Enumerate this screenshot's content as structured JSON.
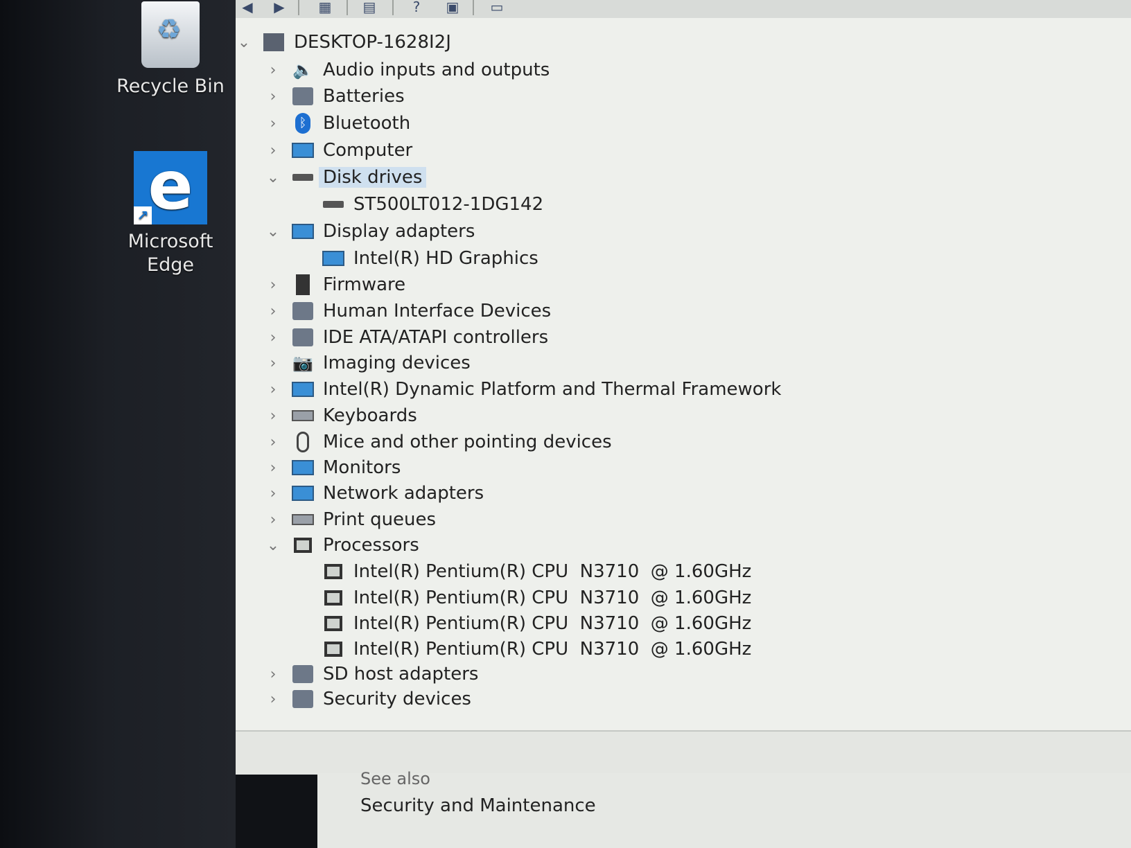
{
  "desktop": {
    "icons": [
      {
        "label": "Recycle Bin",
        "icon": "recycle-bin-icon"
      },
      {
        "label": "Microsoft Edge",
        "icon": "edge-icon"
      }
    ]
  },
  "toolbar": {
    "buttons": [
      "back-icon",
      "forward-icon",
      "show-hide-icon",
      "properties-icon",
      "help-icon",
      "update-driver-icon",
      "scan-hardware-icon"
    ]
  },
  "tree": {
    "root": "DESKTOP-1628I2J",
    "items": [
      {
        "label": "Audio inputs and outputs",
        "expanded": false,
        "icon": "speaker-icon"
      },
      {
        "label": "Batteries",
        "expanded": false,
        "icon": "battery-icon"
      },
      {
        "label": "Bluetooth",
        "expanded": false,
        "icon": "bluetooth-icon"
      },
      {
        "label": "Computer",
        "expanded": false,
        "icon": "computer-icon"
      },
      {
        "label": "Disk drives",
        "expanded": true,
        "selected": true,
        "icon": "disk-drive-icon",
        "children": [
          {
            "label": "ST500LT012-1DG142",
            "icon": "disk-drive-icon"
          }
        ]
      },
      {
        "label": "Display adapters",
        "expanded": true,
        "icon": "display-adapter-icon",
        "children": [
          {
            "label": "Intel(R) HD Graphics",
            "icon": "display-adapter-icon"
          }
        ]
      },
      {
        "label": "Firmware",
        "expanded": false,
        "icon": "firmware-icon"
      },
      {
        "label": "Human Interface Devices",
        "expanded": false,
        "icon": "hid-icon"
      },
      {
        "label": "IDE ATA/ATAPI controllers",
        "expanded": false,
        "icon": "ide-controller-icon"
      },
      {
        "label": "Imaging devices",
        "expanded": false,
        "icon": "camera-icon"
      },
      {
        "label": "Intel(R) Dynamic Platform and Thermal Framework",
        "expanded": false,
        "icon": "folder-icon"
      },
      {
        "label": "Keyboards",
        "expanded": false,
        "icon": "keyboard-icon"
      },
      {
        "label": "Mice and other pointing devices",
        "expanded": false,
        "icon": "mouse-icon"
      },
      {
        "label": "Monitors",
        "expanded": false,
        "icon": "monitor-icon"
      },
      {
        "label": "Network adapters",
        "expanded": false,
        "icon": "network-icon"
      },
      {
        "label": "Print queues",
        "expanded": false,
        "icon": "printer-icon"
      },
      {
        "label": "Processors",
        "expanded": true,
        "icon": "processor-icon",
        "children": [
          {
            "label": "Intel(R) Pentium(R) CPU  N3710  @ 1.60GHz",
            "icon": "processor-icon"
          },
          {
            "label": "Intel(R) Pentium(R) CPU  N3710  @ 1.60GHz",
            "icon": "processor-icon"
          },
          {
            "label": "Intel(R) Pentium(R) CPU  N3710  @ 1.60GHz",
            "icon": "processor-icon"
          },
          {
            "label": "Intel(R) Pentium(R) CPU  N3710  @ 1.60GHz",
            "icon": "processor-icon"
          }
        ]
      },
      {
        "label": "SD host adapters",
        "expanded": false,
        "icon": "sd-card-icon"
      },
      {
        "label": "Security devices",
        "expanded": false,
        "icon": "security-device-icon"
      }
    ]
  },
  "background_panel": {
    "see_also": "See also",
    "link": "Security and Maintenance"
  }
}
